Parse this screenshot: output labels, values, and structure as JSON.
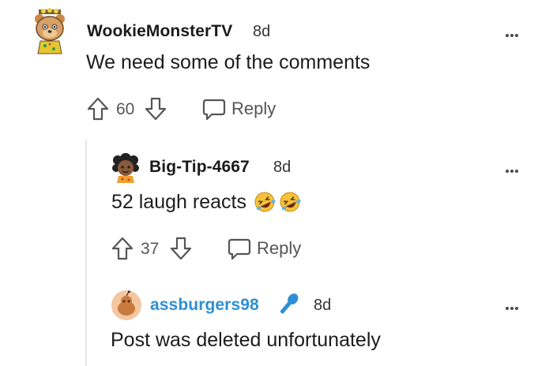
{
  "comments": [
    {
      "username": "WookieMonsterTV",
      "time": "8d",
      "text": "We need some of the comments",
      "upvotes": "60",
      "reply_label": "Reply",
      "avatar_icon": "snoo-avatar-bear-icon"
    },
    {
      "username": "Big-Tip-4667",
      "time": "8d",
      "text": "52 laugh reacts",
      "emoji": "rolling-on-floor-laughing-icon",
      "upvotes": "37",
      "reply_label": "Reply",
      "avatar_icon": "snoo-avatar-curly-hair-icon"
    },
    {
      "username": "assburgers98",
      "username_color": "#2e8fd4",
      "time": "8d",
      "text": "Post was deleted unfortunately",
      "flair_icon": "microphone-icon",
      "avatar_icon": "snoo-avatar-default-icon"
    }
  ],
  "colors": {
    "text": "#1c1c1c",
    "muted": "#555555",
    "thread_line": "#e4e4e4",
    "op_blue": "#2e8fd4"
  }
}
